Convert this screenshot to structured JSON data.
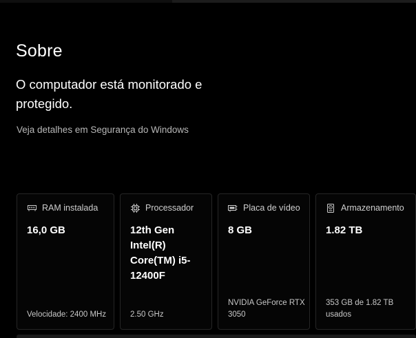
{
  "about": {
    "title": "Sobre",
    "status": "O computador está monitorado e protegido.",
    "details_link": "Veja detalhes em Segurança do Windows"
  },
  "cards": [
    {
      "label": "RAM instalada",
      "icon": "ram-icon",
      "value": "16,0 GB",
      "footer": "Velocidade: 2400 MHz"
    },
    {
      "label": "Processador",
      "icon": "processor-icon",
      "value": "12th Gen Intel(R) Core(TM) i5-12400F",
      "footer": "2.50 GHz"
    },
    {
      "label": "Placa de vídeo",
      "icon": "graphics-card-icon",
      "value": "8 GB",
      "footer": "NVIDIA GeForce RTX 3050"
    },
    {
      "label": "Armazenamento",
      "icon": "storage-icon",
      "value": "1.82 TB",
      "footer": "353 GB de 1.82 TB usados"
    }
  ],
  "colors": {
    "background": "#000000",
    "card_border": "#262626",
    "secondary_text": "#b8b8b8"
  }
}
